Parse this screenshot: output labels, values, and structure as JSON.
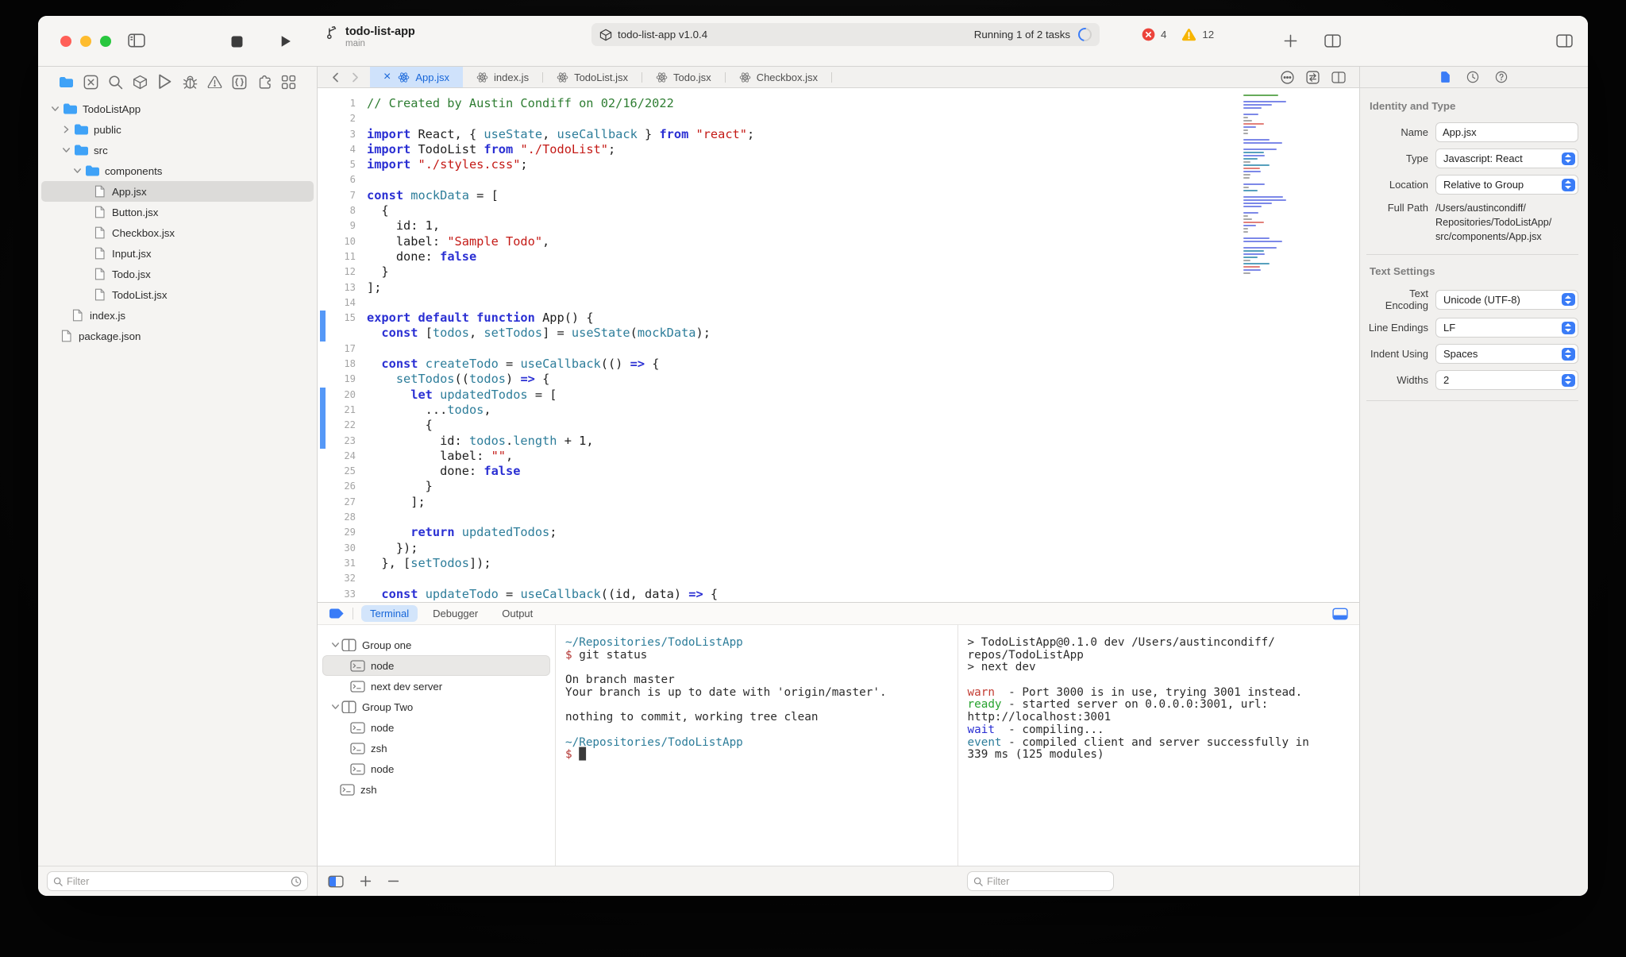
{
  "window": {
    "title": "todo-list-app",
    "branch": "main"
  },
  "toolbar": {
    "package_label": "todo-list-app v1.0.4",
    "running_label": "Running 1 of 2 tasks",
    "error_count": "4",
    "warning_count": "12"
  },
  "colors": {
    "accent": "#3a7cf7",
    "tab_active_bg": "#cfe2fb",
    "error": "#ec443b",
    "warning": "#f7b500",
    "folder": "#3fa2f7",
    "syntax": {
      "keyword": "#2a2fd3",
      "identifier": "#2d7d9a",
      "string": "#c41a16",
      "comment": "#2e7d32"
    }
  },
  "navigator": {
    "icons": [
      {
        "name": "project-navigator-icon",
        "glyph": "folder",
        "active": true
      },
      {
        "name": "symbols-navigator-icon",
        "glyph": "symbols"
      },
      {
        "name": "search-navigator-icon",
        "glyph": "search"
      },
      {
        "name": "package-navigator-icon",
        "glyph": "package"
      },
      {
        "name": "run-navigator-icon",
        "glyph": "play"
      },
      {
        "name": "debug-navigator-icon",
        "glyph": "bug"
      },
      {
        "name": "issues-navigator-icon",
        "glyph": "warning"
      },
      {
        "name": "snippets-navigator-icon",
        "glyph": "braces"
      },
      {
        "name": "extensions-navigator-icon",
        "glyph": "puzzle"
      },
      {
        "name": "overview-navigator-icon",
        "glyph": "grid"
      }
    ]
  },
  "sidebar": {
    "filter_placeholder": "Filter",
    "tree": [
      {
        "label": "TodoListApp",
        "type": "folder",
        "level": 0,
        "chev": "open"
      },
      {
        "label": "public",
        "type": "folder",
        "level": 1,
        "chev": "closed"
      },
      {
        "label": "src",
        "type": "folder",
        "level": 1,
        "chev": "open"
      },
      {
        "label": "components",
        "type": "folder",
        "level": 2,
        "chev": "open"
      },
      {
        "label": "App.jsx",
        "type": "file",
        "level": 3,
        "selected": true
      },
      {
        "label": "Button.jsx",
        "type": "file",
        "level": 3
      },
      {
        "label": "Checkbox.jsx",
        "type": "file",
        "level": 3
      },
      {
        "label": "Input.jsx",
        "type": "file",
        "level": 3
      },
      {
        "label": "Todo.jsx",
        "type": "file",
        "level": 3
      },
      {
        "label": "TodoList.jsx",
        "type": "file",
        "level": 3
      },
      {
        "label": "index.js",
        "type": "file",
        "level": 1
      },
      {
        "label": "package.json",
        "type": "file",
        "level": 0
      }
    ]
  },
  "editor_tabs": [
    {
      "label": "App.jsx",
      "active": true
    },
    {
      "label": "index.js"
    },
    {
      "label": "TodoList.jsx"
    },
    {
      "label": "Todo.jsx"
    },
    {
      "label": "Checkbox.jsx"
    }
  ],
  "code": {
    "lines": [
      {
        "n": "1",
        "segs": [
          [
            "c",
            "// Created by Austin Condiff on 02/16/2022"
          ]
        ]
      },
      {
        "n": "2",
        "segs": []
      },
      {
        "n": "3",
        "segs": [
          [
            "k",
            "import"
          ],
          [
            "p",
            " React, { "
          ],
          [
            "t",
            "useState"
          ],
          [
            "p",
            ", "
          ],
          [
            "t",
            "useCallback"
          ],
          [
            "p",
            " } "
          ],
          [
            "k",
            "from"
          ],
          [
            "p",
            " "
          ],
          [
            "s",
            "\"react\""
          ],
          [
            "p",
            ";"
          ]
        ]
      },
      {
        "n": "4",
        "segs": [
          [
            "k",
            "import"
          ],
          [
            "p",
            " TodoList "
          ],
          [
            "k",
            "from"
          ],
          [
            "p",
            " "
          ],
          [
            "s",
            "\"./TodoList\""
          ],
          [
            "p",
            ";"
          ]
        ]
      },
      {
        "n": "5",
        "segs": [
          [
            "k",
            "import"
          ],
          [
            "p",
            " "
          ],
          [
            "s",
            "\"./styles.css\""
          ],
          [
            "p",
            ";"
          ]
        ]
      },
      {
        "n": "6",
        "segs": []
      },
      {
        "n": "7",
        "segs": [
          [
            "k",
            "const"
          ],
          [
            "p",
            " "
          ],
          [
            "t",
            "mockData"
          ],
          [
            "p",
            " = ["
          ]
        ]
      },
      {
        "n": "8",
        "segs": [
          [
            "p",
            "  {"
          ]
        ]
      },
      {
        "n": "9",
        "segs": [
          [
            "p",
            "    id: 1,"
          ]
        ]
      },
      {
        "n": "10",
        "segs": [
          [
            "p",
            "    label: "
          ],
          [
            "s",
            "\"Sample Todo\""
          ],
          [
            "p",
            ","
          ]
        ]
      },
      {
        "n": "11",
        "segs": [
          [
            "p",
            "    done: "
          ],
          [
            "k",
            "false"
          ]
        ]
      },
      {
        "n": "12",
        "segs": [
          [
            "p",
            "  }"
          ]
        ]
      },
      {
        "n": "13",
        "segs": [
          [
            "p",
            "];"
          ]
        ]
      },
      {
        "n": "14",
        "segs": []
      },
      {
        "n": "15",
        "bar": true,
        "segs": [
          [
            "k",
            "export"
          ],
          [
            "p",
            " "
          ],
          [
            "k",
            "default"
          ],
          [
            "p",
            " "
          ],
          [
            "k",
            "function"
          ],
          [
            "p",
            " App() {"
          ]
        ]
      },
      {
        "n": "",
        "bar": true,
        "segs": [
          [
            "p",
            "  "
          ],
          [
            "k",
            "const"
          ],
          [
            "p",
            " ["
          ],
          [
            "t",
            "todos"
          ],
          [
            "p",
            ", "
          ],
          [
            "t",
            "setTodos"
          ],
          [
            "p",
            "] = "
          ],
          [
            "t",
            "useState"
          ],
          [
            "p",
            "("
          ],
          [
            "t",
            "mockData"
          ],
          [
            "p",
            ");"
          ]
        ]
      },
      {
        "n": "17",
        "segs": []
      },
      {
        "n": "18",
        "segs": [
          [
            "p",
            "  "
          ],
          [
            "k",
            "const"
          ],
          [
            "p",
            " "
          ],
          [
            "t",
            "createTodo"
          ],
          [
            "p",
            " = "
          ],
          [
            "t",
            "useCallback"
          ],
          [
            "p",
            "(() "
          ],
          [
            "k",
            "=>"
          ],
          [
            "p",
            " {"
          ]
        ]
      },
      {
        "n": "19",
        "segs": [
          [
            "p",
            "    "
          ],
          [
            "t",
            "setTodos"
          ],
          [
            "p",
            "(("
          ],
          [
            "t",
            "todos"
          ],
          [
            "p",
            ") "
          ],
          [
            "k",
            "=>"
          ],
          [
            "p",
            " {"
          ]
        ]
      },
      {
        "n": "20",
        "bar": true,
        "segs": [
          [
            "p",
            "      "
          ],
          [
            "k",
            "let"
          ],
          [
            "p",
            " "
          ],
          [
            "t",
            "updatedTodos"
          ],
          [
            "p",
            " = ["
          ]
        ]
      },
      {
        "n": "21",
        "bar": true,
        "segs": [
          [
            "p",
            "        ..."
          ],
          [
            "t",
            "todos"
          ],
          [
            "p",
            ","
          ]
        ]
      },
      {
        "n": "22",
        "bar": true,
        "segs": [
          [
            "p",
            "        {"
          ]
        ]
      },
      {
        "n": "23",
        "bar": true,
        "segs": [
          [
            "p",
            "          id: "
          ],
          [
            "t",
            "todos"
          ],
          [
            "p",
            "."
          ],
          [
            "t",
            "length"
          ],
          [
            "p",
            " + 1,"
          ]
        ]
      },
      {
        "n": "24",
        "segs": [
          [
            "p",
            "          label: "
          ],
          [
            "s",
            "\"\""
          ],
          [
            "p",
            ","
          ]
        ]
      },
      {
        "n": "25",
        "segs": [
          [
            "p",
            "          done: "
          ],
          [
            "k",
            "false"
          ]
        ]
      },
      {
        "n": "26",
        "segs": [
          [
            "p",
            "        }"
          ]
        ]
      },
      {
        "n": "27",
        "segs": [
          [
            "p",
            "      ];"
          ]
        ]
      },
      {
        "n": "28",
        "segs": []
      },
      {
        "n": "29",
        "segs": [
          [
            "p",
            "      "
          ],
          [
            "k",
            "return"
          ],
          [
            "p",
            " "
          ],
          [
            "t",
            "updatedTodos"
          ],
          [
            "p",
            ";"
          ]
        ]
      },
      {
        "n": "30",
        "segs": [
          [
            "p",
            "    });"
          ]
        ]
      },
      {
        "n": "31",
        "segs": [
          [
            "p",
            "  }, ["
          ],
          [
            "t",
            "setTodos"
          ],
          [
            "p",
            "]);"
          ]
        ]
      },
      {
        "n": "32",
        "segs": []
      },
      {
        "n": "33",
        "segs": [
          [
            "p",
            "  "
          ],
          [
            "k",
            "const"
          ],
          [
            "p",
            " "
          ],
          [
            "t",
            "updateTodo"
          ],
          [
            "p",
            " = "
          ],
          [
            "t",
            "useCallback"
          ],
          [
            "p",
            "((id, data) "
          ],
          [
            "k",
            "=>"
          ],
          [
            "p",
            " {"
          ]
        ]
      }
    ]
  },
  "panel": {
    "tabs": [
      {
        "label": "Terminal",
        "active": true
      },
      {
        "label": "Debugger"
      },
      {
        "label": "Output"
      }
    ],
    "filter_placeholder": "Filter",
    "tree": [
      {
        "label": "Group one",
        "type": "group",
        "level": 0,
        "chev": "open"
      },
      {
        "label": "node",
        "type": "term",
        "level": 1,
        "selected": true
      },
      {
        "label": "next dev server",
        "type": "term",
        "level": 1
      },
      {
        "label": "Group Two",
        "type": "group",
        "level": 0,
        "chev": "open"
      },
      {
        "label": "node",
        "type": "term",
        "level": 1
      },
      {
        "label": "zsh",
        "type": "term",
        "level": 1
      },
      {
        "label": "node",
        "type": "term",
        "level": 1
      },
      {
        "label": "zsh",
        "type": "term",
        "level": 0.5
      }
    ]
  },
  "terminals": {
    "middle": [
      [
        [
          "path",
          "~/Repositories/TodoListApp"
        ]
      ],
      [
        [
          "prompt",
          "$ "
        ],
        [
          "plain",
          "git status"
        ]
      ],
      [],
      [
        [
          "plain",
          "On branch master"
        ]
      ],
      [
        [
          "plain",
          "Your branch is up to date with 'origin/master'."
        ]
      ],
      [],
      [
        [
          "plain",
          "nothing to commit, working tree clean"
        ]
      ],
      [],
      [
        [
          "path",
          "~/Repositories/TodoListApp"
        ]
      ],
      [
        [
          "prompt",
          "$ "
        ],
        [
          "cursor",
          "█"
        ]
      ]
    ],
    "right": [
      [
        [
          "plain",
          "> TodoListApp@0.1.0 dev /Users/austincondiff/"
        ]
      ],
      [
        [
          "plain",
          "repos/TodoListApp"
        ]
      ],
      [
        [
          "plain",
          "> next dev"
        ]
      ],
      [],
      [
        [
          "warn",
          "warn"
        ],
        [
          "plain",
          "  - Port 3000 is in use, trying 3001 instead."
        ]
      ],
      [
        [
          "ready",
          "ready"
        ],
        [
          "plain",
          " - started server on 0.0.0.0:3001, url:"
        ]
      ],
      [
        [
          "plain",
          "http://localhost:3001"
        ]
      ],
      [
        [
          "wait",
          "wait"
        ],
        [
          "plain",
          "  - compiling..."
        ]
      ],
      [
        [
          "event",
          "event"
        ],
        [
          "plain",
          " - compiled client and server successfully in"
        ]
      ],
      [
        [
          "plain",
          "339 ms (125 modules)"
        ]
      ]
    ]
  },
  "inspector": {
    "identity_header": "Identity and Type",
    "name_label": "Name",
    "name_value": "App.jsx",
    "type_label": "Type",
    "type_value": "Javascript: React",
    "location_label": "Location",
    "location_value": "Relative to Group",
    "fullpath_label": "Full Path",
    "fullpath_value": "/Users/austincondiff/\nRepositories/TodoListApp/\nsrc/components/App.jsx",
    "text_header": "Text Settings",
    "encoding_label": "Text Encoding",
    "encoding_value": "Unicode (UTF-8)",
    "lineendings_label": "Line Endings",
    "lineendings_value": "LF",
    "indent_label": "Indent Using",
    "indent_value": "Spaces",
    "widths_label": "Widths",
    "widths_value": "2"
  }
}
